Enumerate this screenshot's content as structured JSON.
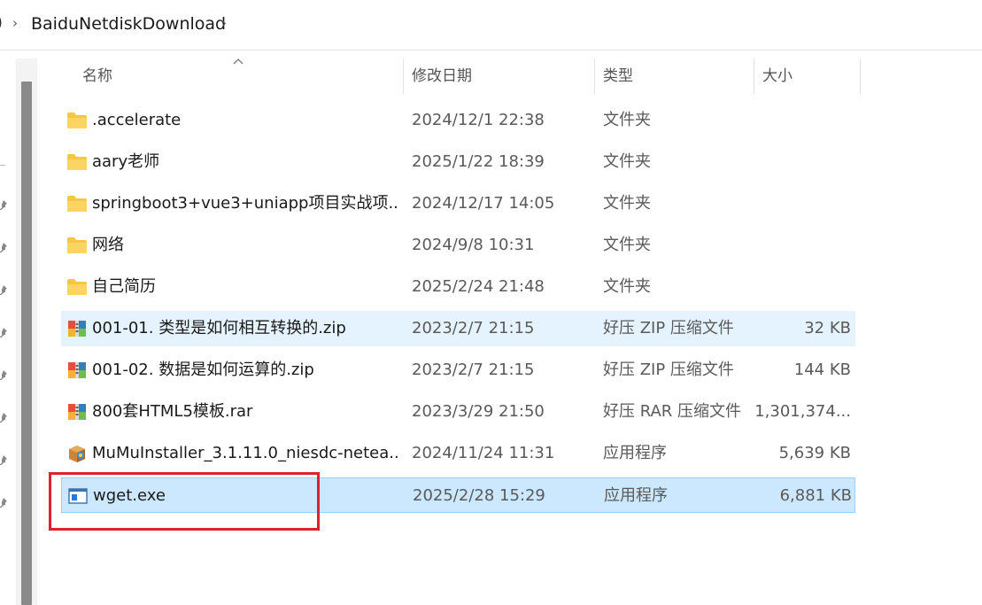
{
  "address_bar": {
    "edge_glyph": ")",
    "separator": "›",
    "crumb": "BaiduNetdiskDownload"
  },
  "columns": {
    "name": "名称",
    "date": "修改日期",
    "type": "类型",
    "size": "大小"
  },
  "files": [
    {
      "name": ".accelerate",
      "date": "2024/12/1 22:38",
      "type": "文件夹",
      "size": "",
      "icon": "folder-icon"
    },
    {
      "name": "aary老师",
      "date": "2025/1/22 18:39",
      "type": "文件夹",
      "size": "",
      "icon": "folder-icon"
    },
    {
      "name": "springboot3+vue3+uniapp项目实战项...",
      "date": "2024/12/17 14:05",
      "type": "文件夹",
      "size": "",
      "icon": "folder-icon"
    },
    {
      "name": "网络",
      "date": "2024/9/8 10:31",
      "type": "文件夹",
      "size": "",
      "icon": "folder-icon"
    },
    {
      "name": "自己简历",
      "date": "2025/2/24 21:48",
      "type": "文件夹",
      "size": "",
      "icon": "folder-icon"
    },
    {
      "name": "001-01. 类型是如何相互转换的.zip",
      "date": "2023/2/7 21:15",
      "type": "好压 ZIP 压缩文件",
      "size": "32 KB",
      "icon": "archive-icon",
      "state": "hover"
    },
    {
      "name": "001-02. 数据是如何运算的.zip",
      "date": "2023/2/7 21:15",
      "type": "好压 ZIP 压缩文件",
      "size": "144 KB",
      "icon": "archive-icon"
    },
    {
      "name": "800套HTML5模板.rar",
      "date": "2023/3/29 21:50",
      "type": "好压 RAR 压缩文件",
      "size": "1,301,374...",
      "icon": "archive-icon"
    },
    {
      "name": "MuMuInstaller_3.1.11.0_niesdc-netea...",
      "date": "2024/11/24 11:31",
      "type": "应用程序",
      "size": "5,639 KB",
      "icon": "installer-icon"
    },
    {
      "name": "wget.exe",
      "date": "2025/2/28 15:29",
      "type": "应用程序",
      "size": "6,881 KB",
      "icon": "exe-icon",
      "state": "selected"
    }
  ],
  "colors": {
    "hover_row": "#e5f3ff",
    "selected_row": "#cce8ff",
    "annotation": "#e0202c",
    "folder": "#f8c646"
  }
}
